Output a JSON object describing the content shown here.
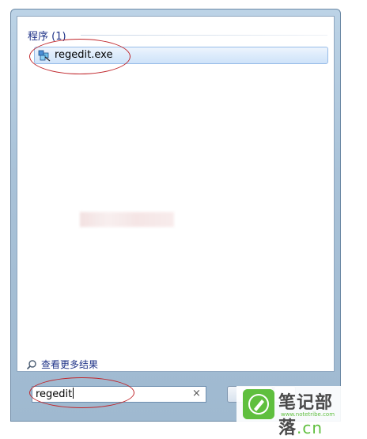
{
  "results_section": {
    "title": "程序 (1)",
    "items": [
      {
        "label": "regedit.exe",
        "icon": "regedit-icon"
      }
    ]
  },
  "more_results": {
    "label": "查看更多结果",
    "icon": "search-icon"
  },
  "search": {
    "value": "regedit",
    "clear_icon": "×"
  },
  "watermark": {
    "name_main": "笔记部落",
    "name_suffix": ".cn",
    "url": "www.notetribe.com",
    "color": "#5fbf3e"
  },
  "annotation_color": "#c0262b"
}
